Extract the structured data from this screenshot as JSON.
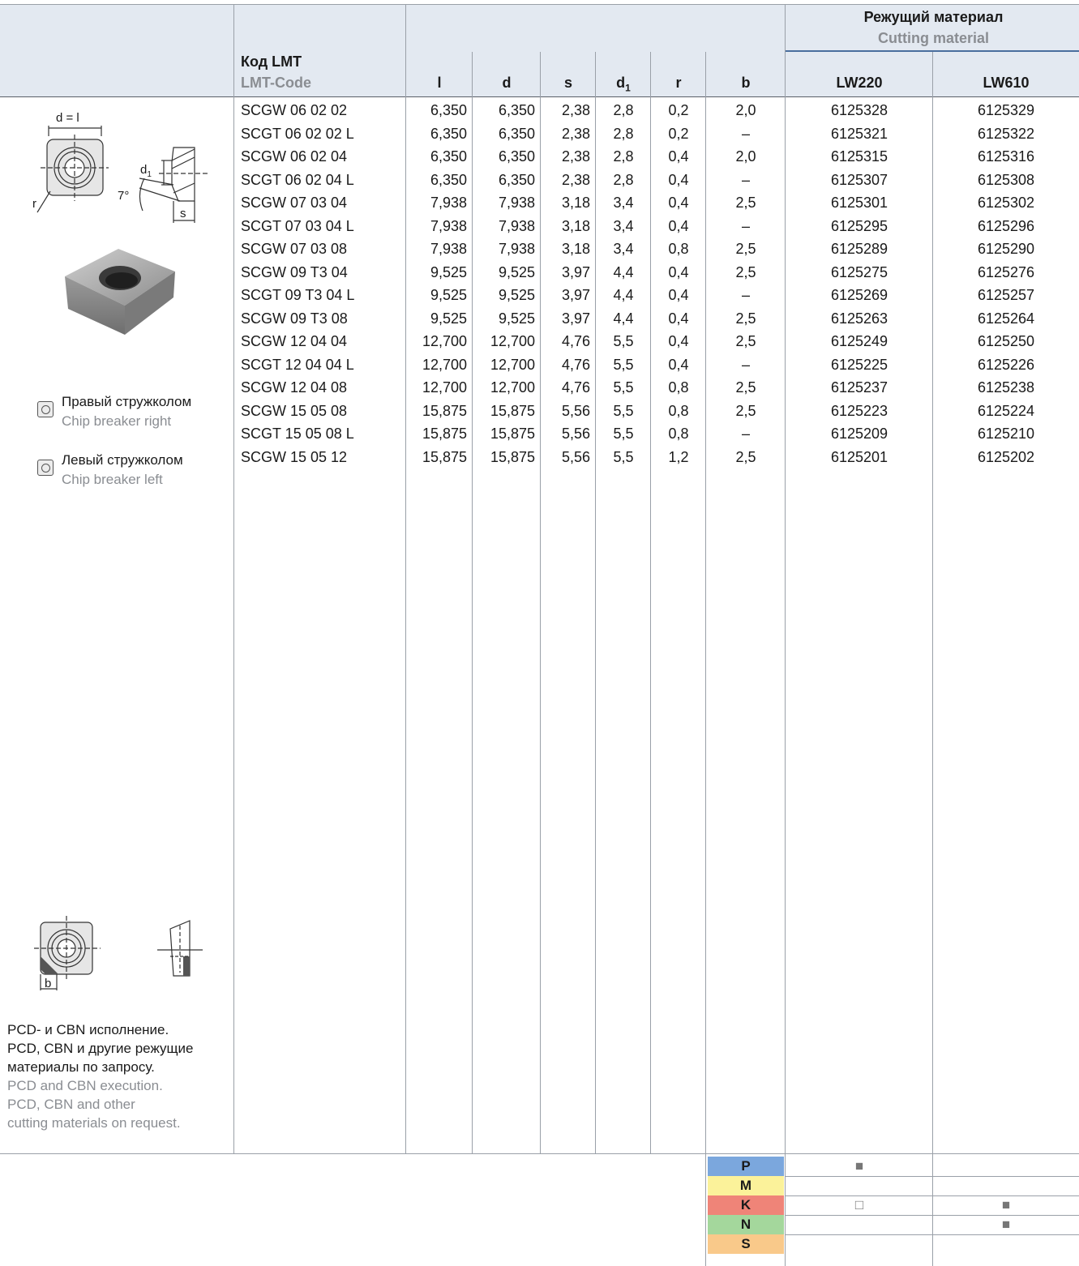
{
  "header": {
    "code_ru": "Код LMT",
    "code_en": "LMT-Code",
    "cutting_material_ru": "Режущий материал",
    "cutting_material_en": "Cutting material",
    "columns": {
      "l": "l",
      "d": "d",
      "s": "s",
      "d1_base": "d",
      "d1_sub": "1",
      "r": "r",
      "b": "b"
    },
    "grades": [
      "LW220",
      "LW610"
    ]
  },
  "rows": [
    {
      "code": "SCGW 06 02 02",
      "l": "6,350",
      "d": "6,350",
      "s": "2,38",
      "d1": "2,8",
      "r": "0,2",
      "b": "2,0",
      "lw220": "6125328",
      "lw610": "6125329"
    },
    {
      "code": "SCGT 06 02 02 L",
      "l": "6,350",
      "d": "6,350",
      "s": "2,38",
      "d1": "2,8",
      "r": "0,2",
      "b": "–",
      "lw220": "6125321",
      "lw610": "6125322"
    },
    {
      "code": "SCGW 06 02 04",
      "l": "6,350",
      "d": "6,350",
      "s": "2,38",
      "d1": "2,8",
      "r": "0,4",
      "b": "2,0",
      "lw220": "6125315",
      "lw610": "6125316"
    },
    {
      "code": "SCGT 06 02 04 L",
      "l": "6,350",
      "d": "6,350",
      "s": "2,38",
      "d1": "2,8",
      "r": "0,4",
      "b": "–",
      "lw220": "6125307",
      "lw610": "6125308"
    },
    {
      "code": "SCGW 07 03 04",
      "l": "7,938",
      "d": "7,938",
      "s": "3,18",
      "d1": "3,4",
      "r": "0,4",
      "b": "2,5",
      "lw220": "6125301",
      "lw610": "6125302"
    },
    {
      "code": "SCGT 07 03 04 L",
      "l": "7,938",
      "d": "7,938",
      "s": "3,18",
      "d1": "3,4",
      "r": "0,4",
      "b": "–",
      "lw220": "6125295",
      "lw610": "6125296"
    },
    {
      "code": "SCGW 07 03 08",
      "l": "7,938",
      "d": "7,938",
      "s": "3,18",
      "d1": "3,4",
      "r": "0,8",
      "b": "2,5",
      "lw220": "6125289",
      "lw610": "6125290"
    },
    {
      "code": "SCGW 09 T3 04",
      "l": "9,525",
      "d": "9,525",
      "s": "3,97",
      "d1": "4,4",
      "r": "0,4",
      "b": "2,5",
      "lw220": "6125275",
      "lw610": "6125276"
    },
    {
      "code": "SCGT 09 T3 04 L",
      "l": "9,525",
      "d": "9,525",
      "s": "3,97",
      "d1": "4,4",
      "r": "0,4",
      "b": "–",
      "lw220": "6125269",
      "lw610": "6125257"
    },
    {
      "code": "SCGW 09 T3 08",
      "l": "9,525",
      "d": "9,525",
      "s": "3,97",
      "d1": "4,4",
      "r": "0,4",
      "b": "2,5",
      "lw220": "6125263",
      "lw610": "6125264"
    },
    {
      "code": "SCGW 12 04 04",
      "l": "12,700",
      "d": "12,700",
      "s": "4,76",
      "d1": "5,5",
      "r": "0,4",
      "b": "2,5",
      "lw220": "6125249",
      "lw610": "6125250"
    },
    {
      "code": "SCGT 12 04 04 L",
      "l": "12,700",
      "d": "12,700",
      "s": "4,76",
      "d1": "5,5",
      "r": "0,4",
      "b": "–",
      "lw220": "6125225",
      "lw610": "6125226"
    },
    {
      "code": "SCGW 12 04 08",
      "l": "12,700",
      "d": "12,700",
      "s": "4,76",
      "d1": "5,5",
      "r": "0,8",
      "b": "2,5",
      "lw220": "6125237",
      "lw610": "6125238"
    },
    {
      "code": "SCGW 15 05 08",
      "l": "15,875",
      "d": "15,875",
      "s": "5,56",
      "d1": "5,5",
      "r": "0,8",
      "b": "2,5",
      "lw220": "6125223",
      "lw610": "6125224"
    },
    {
      "code": "SCGT 15 05 08 L",
      "l": "15,875",
      "d": "15,875",
      "s": "5,56",
      "d1": "5,5",
      "r": "0,8",
      "b": "–",
      "lw220": "6125209",
      "lw610": "6125210"
    },
    {
      "code": "SCGW 15 05 12",
      "l": "15,875",
      "d": "15,875",
      "s": "5,56",
      "d1": "5,5",
      "r": "1,2",
      "b": "2,5",
      "lw220": "6125201",
      "lw610": "6125202"
    }
  ],
  "diagram": {
    "dim_dl": "d = l",
    "dim_r": "r",
    "dim_d": "d",
    "dim_d_sub": "1",
    "dim_angle": "7°",
    "dim_s": "s",
    "dim_b": "b"
  },
  "legend": {
    "right_ru": "Правый стружколом",
    "right_en": "Chip breaker right",
    "left_ru": "Левый стружколом",
    "left_en": "Chip breaker left"
  },
  "note": {
    "ru": [
      "PCD- и CBN исполнение.",
      "PCD, CBN и другие режущие",
      "материалы по запросу."
    ],
    "en": [
      "PCD and CBN execution.",
      "PCD, CBN and other",
      "cutting materials on request."
    ]
  },
  "iso_groups": [
    {
      "letter": "P",
      "color": "#7ba7dd",
      "lw220": "■",
      "lw610": ""
    },
    {
      "letter": "M",
      "color": "#fbf29a",
      "lw220": "",
      "lw610": ""
    },
    {
      "letter": "K",
      "color": "#ef8478",
      "lw220": "□",
      "lw610": "■"
    },
    {
      "letter": "N",
      "color": "#a4d79c",
      "lw220": "",
      "lw610": "■"
    },
    {
      "letter": "S",
      "color": "#f9c98a",
      "lw220": "",
      "lw610": ""
    }
  ]
}
